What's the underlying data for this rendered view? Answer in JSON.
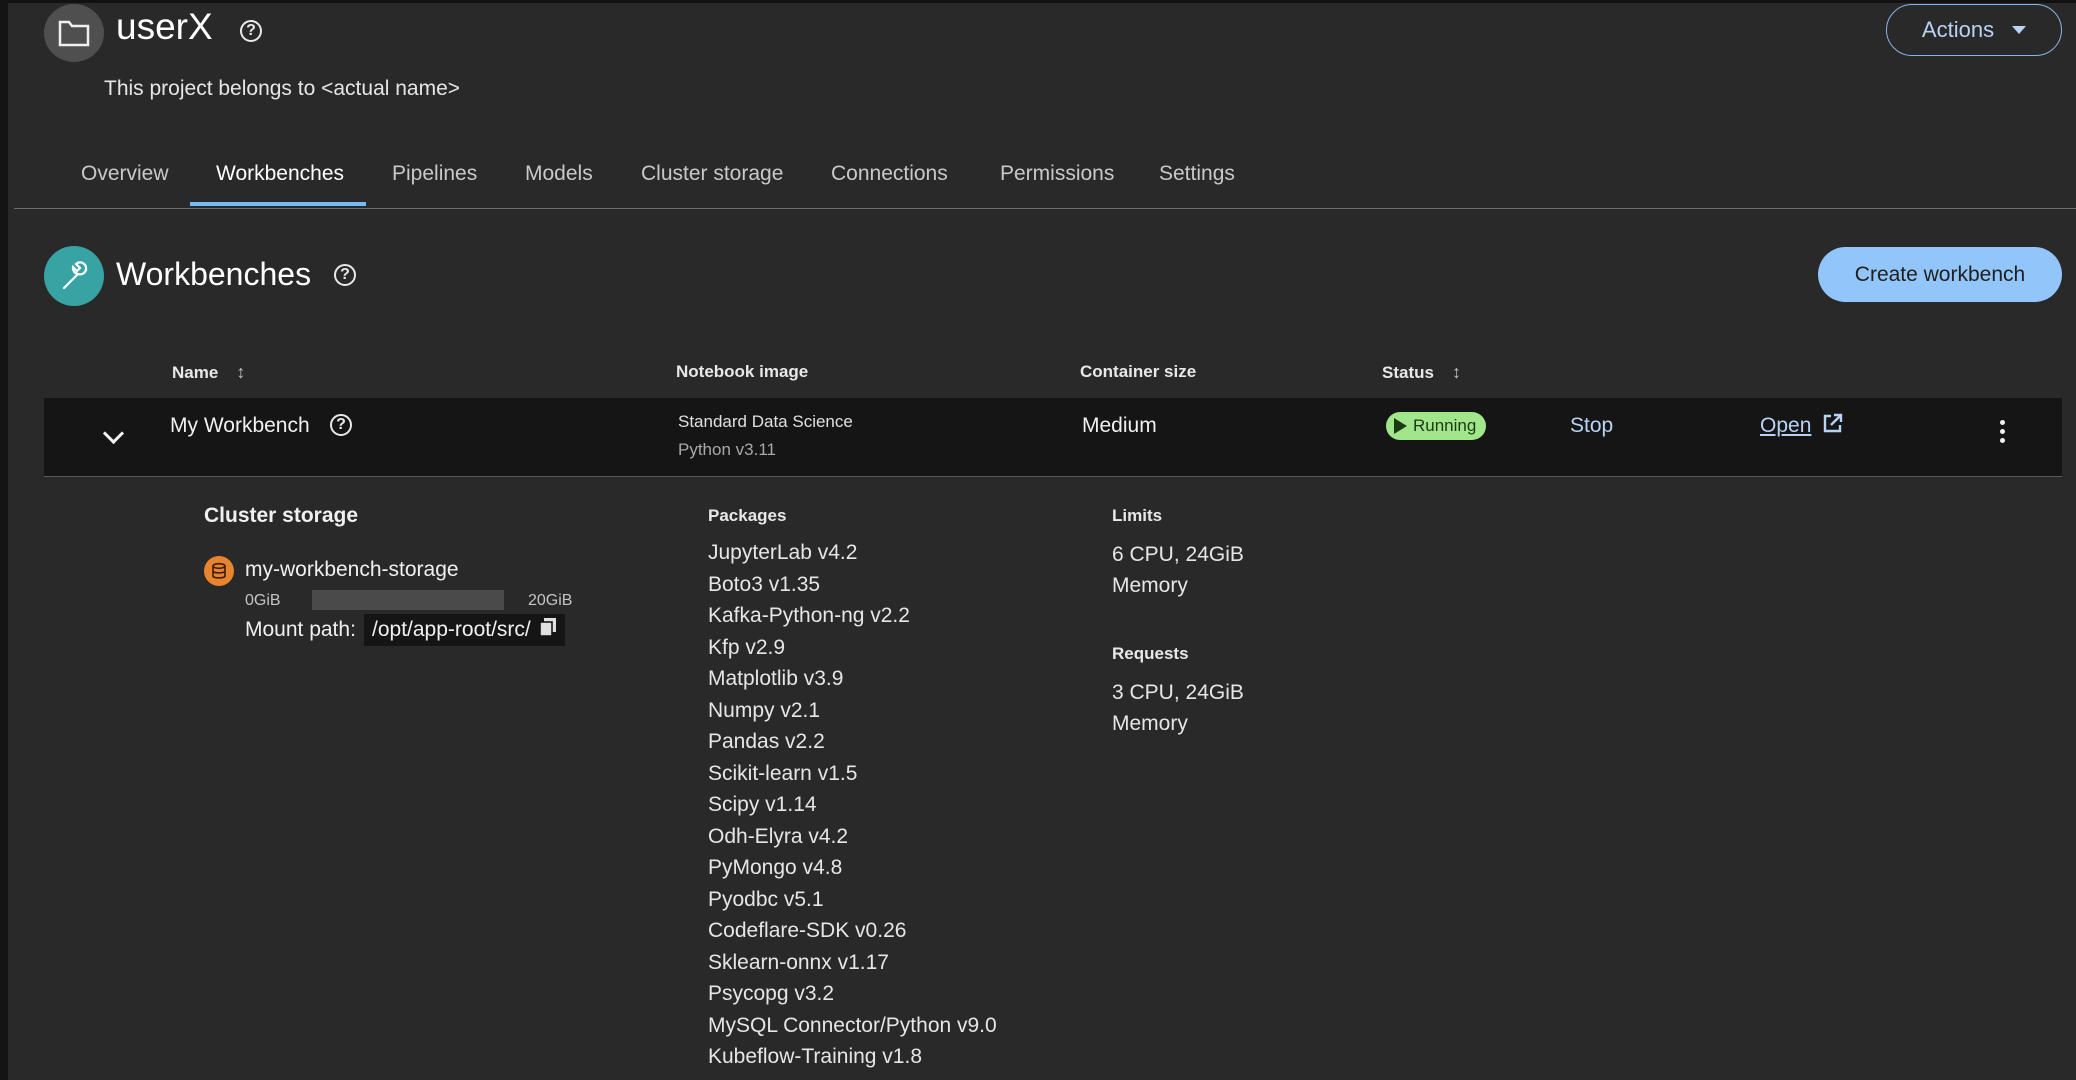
{
  "project": {
    "title": "userX",
    "subtitle": "This project belongs to <actual name>",
    "actions_label": "Actions"
  },
  "tabs": [
    {
      "label": "Overview"
    },
    {
      "label": "Workbenches",
      "active": true
    },
    {
      "label": "Pipelines"
    },
    {
      "label": "Models"
    },
    {
      "label": "Cluster storage"
    },
    {
      "label": "Connections"
    },
    {
      "label": "Permissions"
    },
    {
      "label": "Settings"
    }
  ],
  "section": {
    "title": "Workbenches",
    "create_label": "Create workbench"
  },
  "table": {
    "headers": {
      "name": "Name",
      "image": "Notebook image",
      "size": "Container size",
      "status": "Status"
    },
    "row": {
      "name": "My Workbench",
      "image": "Standard Data Science",
      "image_version": "Python v3.11",
      "size": "Medium",
      "status": "Running",
      "stop_label": "Stop",
      "open_label": "Open"
    }
  },
  "details": {
    "storage": {
      "title": "Cluster storage",
      "name": "my-workbench-storage",
      "min": "0GiB",
      "max": "20GiB",
      "used_fraction": 0.0,
      "mount_label": "Mount path:",
      "mount_path": "/opt/app-root/src/"
    },
    "packages_title": "Packages",
    "packages": [
      "JupyterLab v4.2",
      "Boto3 v1.35",
      "Kafka-Python-ng v2.2",
      "Kfp v2.9",
      "Matplotlib v3.9",
      "Numpy v2.1",
      "Pandas v2.2",
      "Scikit-learn v1.5",
      "Scipy v1.14",
      "Odh-Elyra v4.2",
      "PyMongo v4.8",
      "Pyodbc v5.1",
      "Codeflare-SDK v0.26",
      "Sklearn-onnx v1.17",
      "Psycopg v3.2",
      "MySQL Connector/Python v9.0",
      "Kubeflow-Training v1.8"
    ],
    "limits_title": "Limits",
    "limits_line1": "6 CPU, 24GiB",
    "limits_line2": "Memory",
    "requests_title": "Requests",
    "requests_line1": "3 CPU, 24GiB",
    "requests_line2": "Memory"
  }
}
